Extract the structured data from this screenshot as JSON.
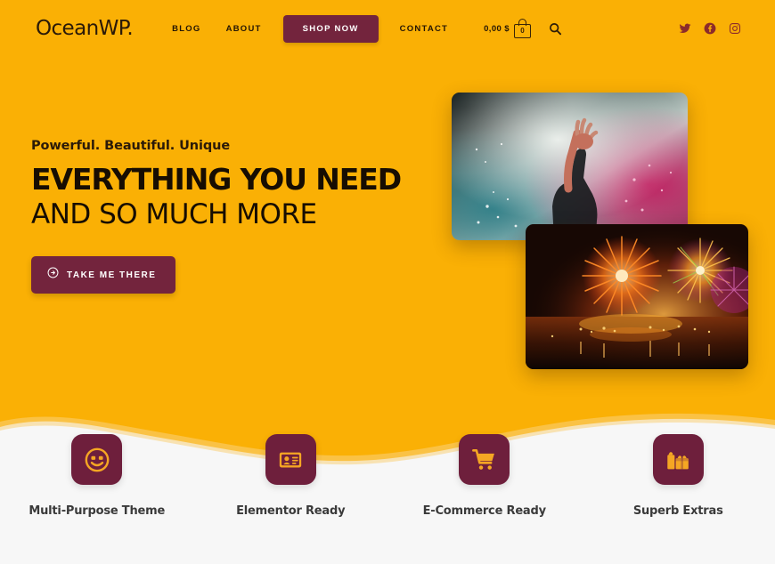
{
  "theme": {
    "bg_orange": "#FAB005",
    "accent_maroon": "#73243D",
    "icon_maroon": "#6E1F3C",
    "section_bg": "#F7F7F7",
    "dark_text": "#170d02",
    "feature_text": "#3a3a3a"
  },
  "header": {
    "logo": "OceanWP.",
    "nav": [
      {
        "label": "BLOG",
        "name": "nav-item-blog"
      },
      {
        "label": "ABOUT",
        "name": "nav-item-about"
      }
    ],
    "shop_now_label": "SHOP NOW",
    "contact_label": "CONTACT",
    "cart": {
      "price": "0,00 $",
      "count": "0",
      "bag_icon": "shopping-bag-icon"
    },
    "search_icon": "search-icon",
    "socials": [
      {
        "name": "twitter-icon",
        "label": "Twitter"
      },
      {
        "name": "facebook-icon",
        "label": "Facebook"
      },
      {
        "name": "instagram-icon",
        "label": "Instagram"
      }
    ]
  },
  "hero": {
    "eyebrow": "Powerful. Beautiful. Unique",
    "headline_bold": "EVERYTHING YOU NEED",
    "headline_light": "AND SO MUCH MORE",
    "cta_label": "TAKE ME THERE",
    "cta_icon": "circle-arrow-right-icon",
    "images": [
      {
        "name": "hero-image-smoke",
        "alt": "Person raising hands in colored smoke"
      },
      {
        "name": "hero-image-fireworks",
        "alt": "Fireworks over water at night"
      }
    ]
  },
  "features": [
    {
      "label": "Multi-Purpose Theme",
      "icon": "smiley-face-icon",
      "name": "feature-multi-purpose-theme"
    },
    {
      "label": "Elementor Ready",
      "icon": "id-card-icon",
      "name": "feature-elementor-ready"
    },
    {
      "label": "E-Commerce Ready",
      "icon": "shopping-cart-icon",
      "name": "feature-ecommerce-ready"
    },
    {
      "label": "Superb Extras",
      "icon": "gift-boxes-icon",
      "name": "feature-superb-extras"
    }
  ]
}
